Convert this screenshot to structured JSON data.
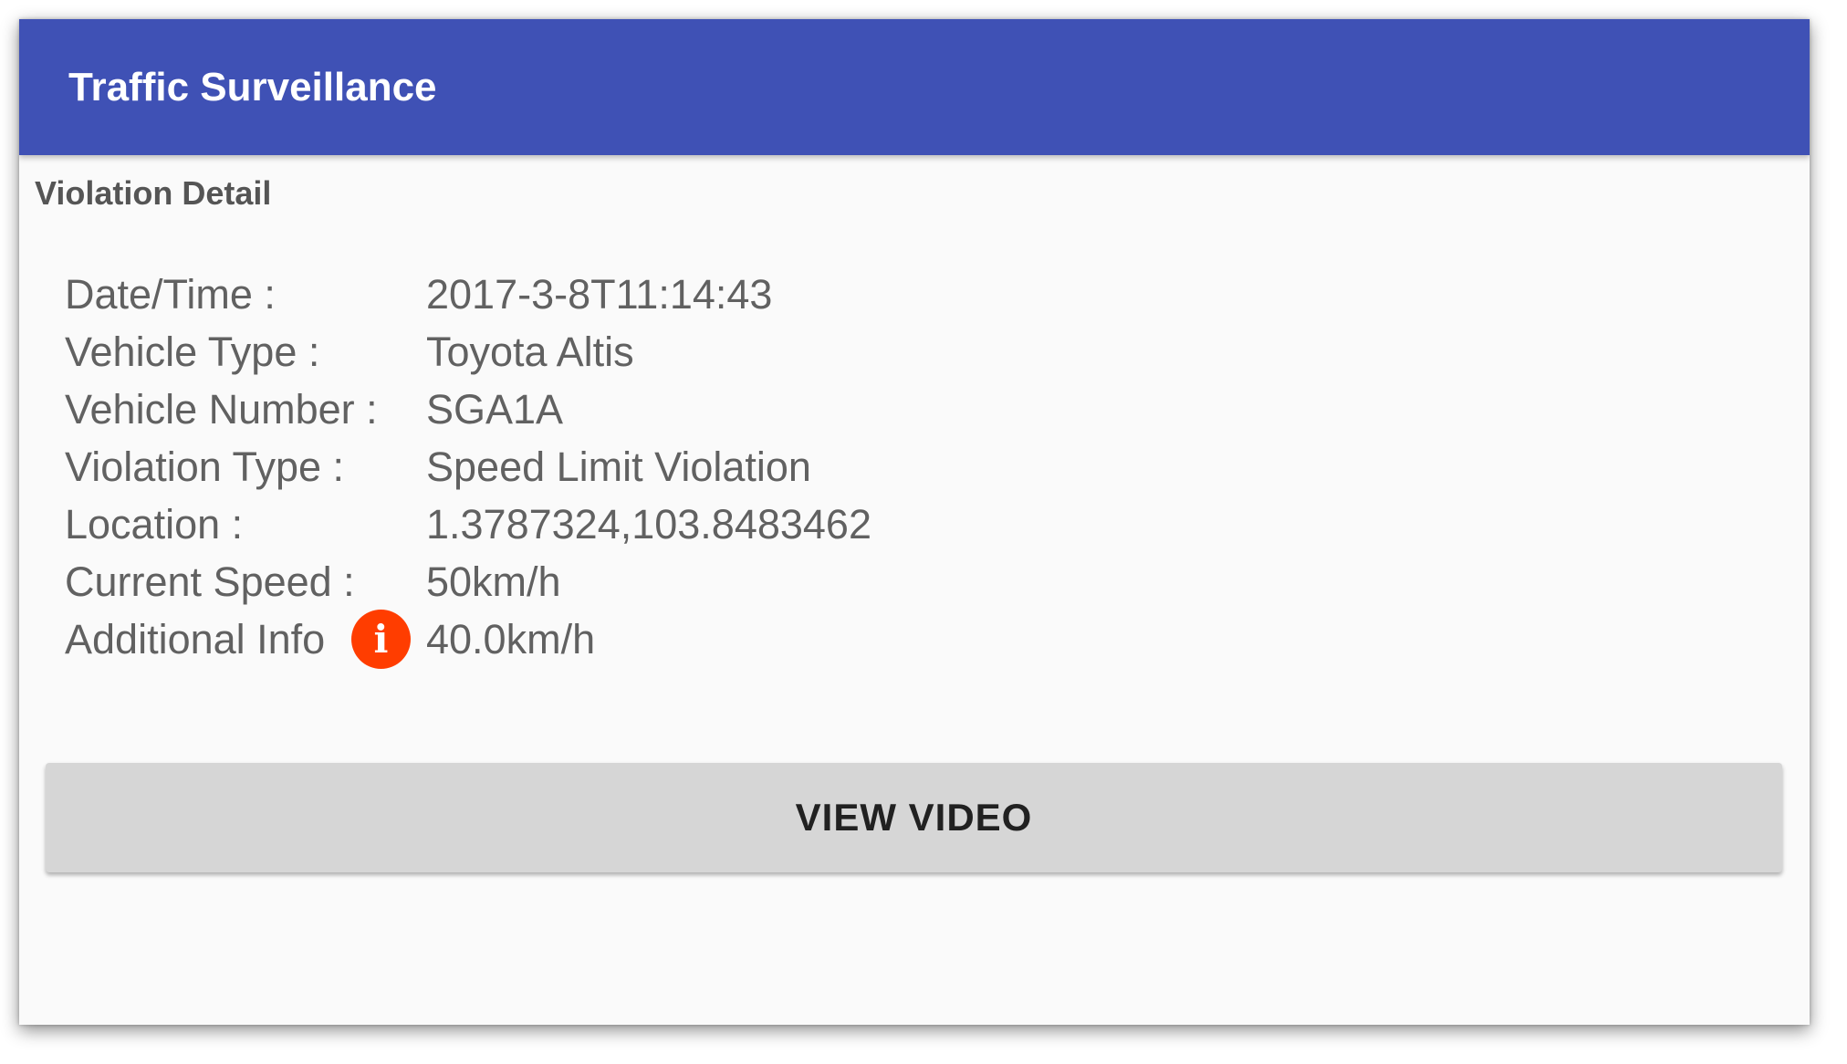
{
  "app": {
    "title": "Traffic Surveillance"
  },
  "section": {
    "title": "Violation Detail"
  },
  "details": [
    {
      "label": "Date/Time :",
      "value": "2017-3-8T11:14:43"
    },
    {
      "label": "Vehicle Type :",
      "value": "Toyota Altis"
    },
    {
      "label": "Vehicle Number :",
      "value": "SGA1A"
    },
    {
      "label": "Violation Type :",
      "value": "Speed Limit Violation"
    },
    {
      "label": "Location :",
      "value": "1.3787324,103.8483462"
    },
    {
      "label": "Current Speed :",
      "value": "50km/h"
    },
    {
      "label": "Additional Info",
      "value": "40.0km/h",
      "icon": "info-icon"
    }
  ],
  "actions": {
    "view_video_label": "VIEW VIDEO"
  },
  "colors": {
    "appbar": "#3f51b5",
    "info_icon": "#ff3d00",
    "button": "#d6d6d6",
    "background": "#fafafa"
  }
}
